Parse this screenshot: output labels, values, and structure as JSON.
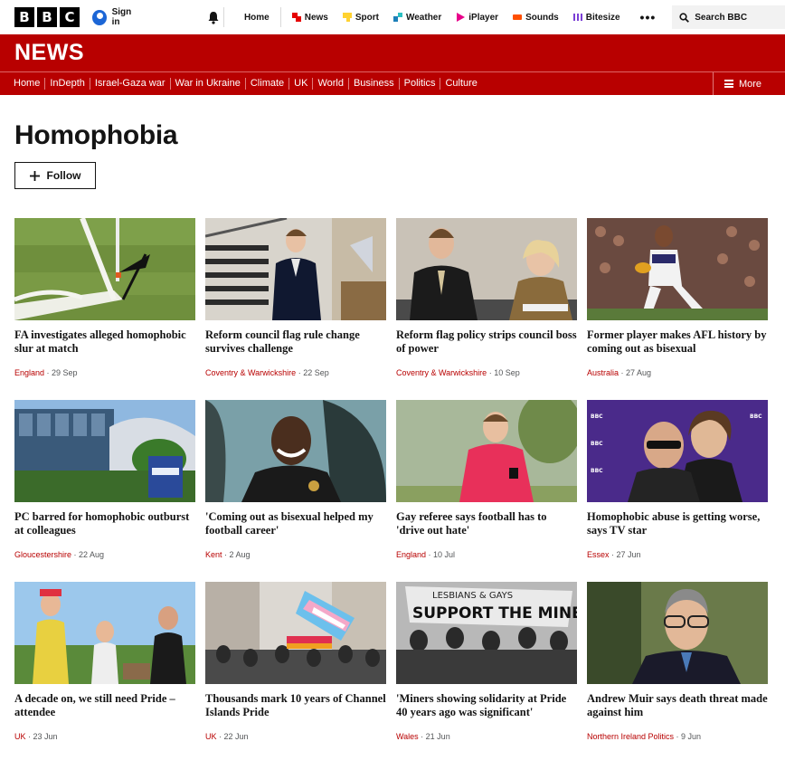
{
  "topbar": {
    "logo_letters": [
      "B",
      "B",
      "C"
    ],
    "signin_label": "Sign in",
    "nav_items": [
      {
        "label": "Home",
        "icon": "none",
        "color": ""
      },
      {
        "label": "News",
        "icon": "news-icon",
        "color": "#e60000"
      },
      {
        "label": "Sport",
        "icon": "sport-icon",
        "color": "#ffd230"
      },
      {
        "label": "Weather",
        "icon": "weather-icon",
        "color": "#1c7fb8"
      },
      {
        "label": "iPlayer",
        "icon": "iplayer-icon",
        "color": "#e8008a"
      },
      {
        "label": "Sounds",
        "icon": "sounds-icon",
        "color": "#ff4f00"
      },
      {
        "label": "Bitesize",
        "icon": "bitesize-icon",
        "color": "#7b3fd6"
      }
    ],
    "more_label": "•••",
    "search_placeholder": "Search BBC"
  },
  "news_header": {
    "brand": "NEWS"
  },
  "subnav": {
    "items": [
      "Home",
      "InDepth",
      "Israel-Gaza war",
      "War in Ukraine",
      "Climate",
      "UK",
      "World",
      "Business",
      "Politics",
      "Culture"
    ],
    "more_label": "More"
  },
  "page": {
    "title": "Homophobia",
    "follow_label": "Follow"
  },
  "articles": [
    {
      "headline": "FA investigates alleged homophobic slur at match",
      "location": "England",
      "date": "29 Sep",
      "image": "football-pitch-corner"
    },
    {
      "headline": "Reform council flag rule change survives challenge",
      "location": "Coventry & Warwickshire",
      "date": "22 Sep",
      "image": "young-man-in-suit-stairs"
    },
    {
      "headline": "Reform flag policy strips council boss of power",
      "location": "Coventry & Warwickshire",
      "date": "10 Sep",
      "image": "council-meeting"
    },
    {
      "headline": "Former player makes AFL history by coming out as bisexual",
      "location": "Australia",
      "date": "27 Aug",
      "image": "afl-player-running"
    },
    {
      "headline": "PC barred for homophobic outburst at colleagues",
      "location": "Gloucestershire",
      "date": "22 Aug",
      "image": "police-headquarters"
    },
    {
      "headline": "'Coming out as bisexual helped my football career'",
      "location": "Kent",
      "date": "2 Aug",
      "image": "smiling-man-selfie"
    },
    {
      "headline": "Gay referee says football has to 'drive out hate'",
      "location": "England",
      "date": "10 Jul",
      "image": "referee-red-kit"
    },
    {
      "headline": "Homophobic abuse is getting worse, says TV star",
      "location": "Essex",
      "date": "27 Jun",
      "image": "couple-at-event"
    },
    {
      "headline": "A decade on, we still need Pride – attendee",
      "location": "UK",
      "date": "23 Jun",
      "image": "pride-attendees"
    },
    {
      "headline": "Thousands mark 10 years of Channel Islands Pride",
      "location": "UK",
      "date": "22 Jun",
      "image": "pride-parade-flags"
    },
    {
      "headline": "'Miners showing solidarity at Pride 40 years ago was significant'",
      "location": "Wales",
      "date": "21 Jun",
      "image": "miners-banner-archive"
    },
    {
      "headline": "Andrew Muir says death threat made against him",
      "location": "Northern Ireland Politics",
      "date": "9 Jun",
      "image": "man-with-glasses"
    }
  ]
}
